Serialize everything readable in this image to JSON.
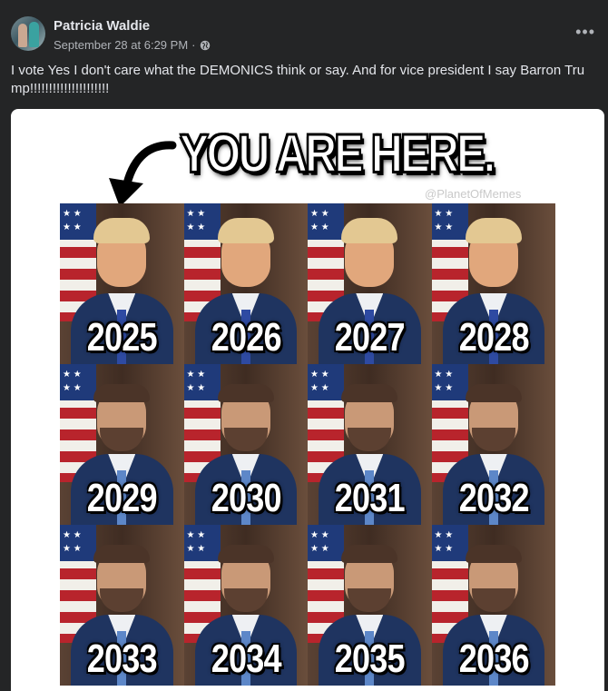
{
  "post": {
    "author": "Patricia Waldie",
    "timestamp": "September 28 at 6:29 PM",
    "separator": "·",
    "audience_icon": "globe-icon",
    "more_label": "•••",
    "text": "I vote Yes I don't care what the DEMONICS think or say. And for vice president I say Barron Trump!!!!!!!!!!!!!!!!!!!!!"
  },
  "image": {
    "headline": "YOU ARE HERE.",
    "arrow_icon": "curved-arrow-icon",
    "watermark": "@PlanetOfMemes",
    "tiles": [
      {
        "year": "2025",
        "person": "trump"
      },
      {
        "year": "2026",
        "person": "trump"
      },
      {
        "year": "2027",
        "person": "trump"
      },
      {
        "year": "2028",
        "person": "trump"
      },
      {
        "year": "2029",
        "person": "vance"
      },
      {
        "year": "2030",
        "person": "vance"
      },
      {
        "year": "2031",
        "person": "vance"
      },
      {
        "year": "2032",
        "person": "vance"
      },
      {
        "year": "2033",
        "person": "vance"
      },
      {
        "year": "2034",
        "person": "vance"
      },
      {
        "year": "2035",
        "person": "vance"
      },
      {
        "year": "2036",
        "person": "vance"
      }
    ]
  },
  "colors": {
    "background": "#242526",
    "text_primary": "#e4e6eb",
    "text_secondary": "#b0b3b8"
  }
}
